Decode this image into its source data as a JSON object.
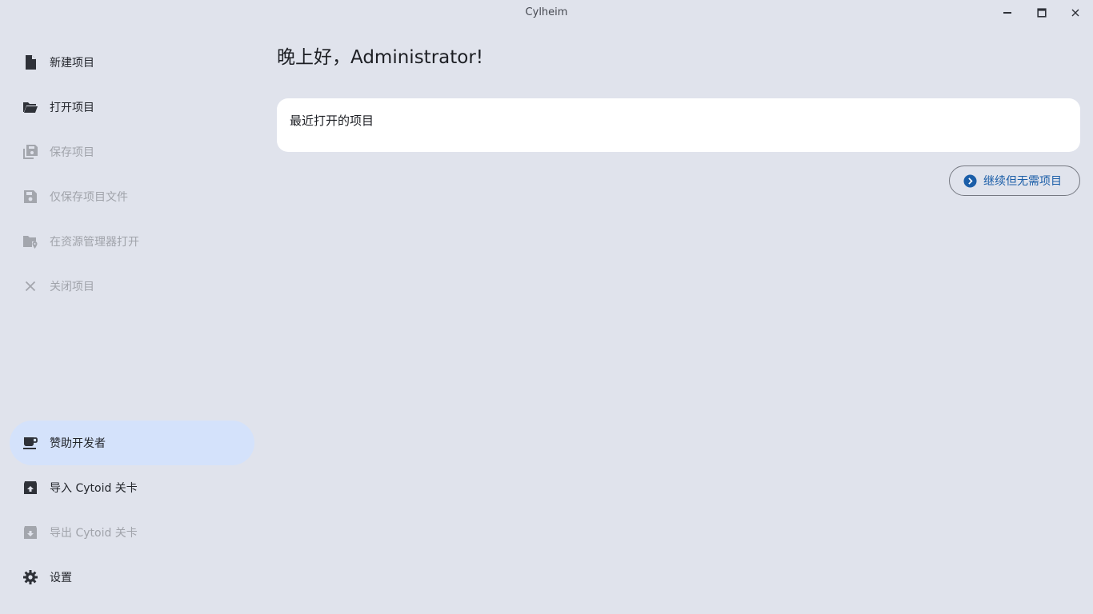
{
  "window": {
    "title": "Cylheim"
  },
  "sidebar": {
    "items": [
      {
        "label": "新建项目",
        "icon": "new-file-icon",
        "enabled": true
      },
      {
        "label": "打开项目",
        "icon": "folder-open-icon",
        "enabled": true
      },
      {
        "label": "保存项目",
        "icon": "save-all-icon",
        "enabled": false
      },
      {
        "label": "仅保存项目文件",
        "icon": "save-icon",
        "enabled": false
      },
      {
        "label": "在资源管理器打开",
        "icon": "folder-location-icon",
        "enabled": false
      },
      {
        "label": "关闭项目",
        "icon": "close-icon",
        "enabled": false
      },
      {
        "label": "赞助开发者",
        "icon": "coffee-icon",
        "enabled": true,
        "active": true
      },
      {
        "label": "导入 Cytoid 关卡",
        "icon": "archive-import-icon",
        "enabled": true
      },
      {
        "label": "导出 Cytoid 关卡",
        "icon": "archive-export-icon",
        "enabled": false
      },
      {
        "label": "设置",
        "icon": "gear-icon",
        "enabled": true
      }
    ]
  },
  "main": {
    "greeting": "晚上好，Administrator!",
    "recent_title": "最近打开的项目",
    "continue_label": "继续但无需项目"
  },
  "colors": {
    "background": "#e0e3ec",
    "active_item": "#d4e2fb",
    "accent": "#1b5ea8",
    "disabled": "#a0a3aa"
  }
}
